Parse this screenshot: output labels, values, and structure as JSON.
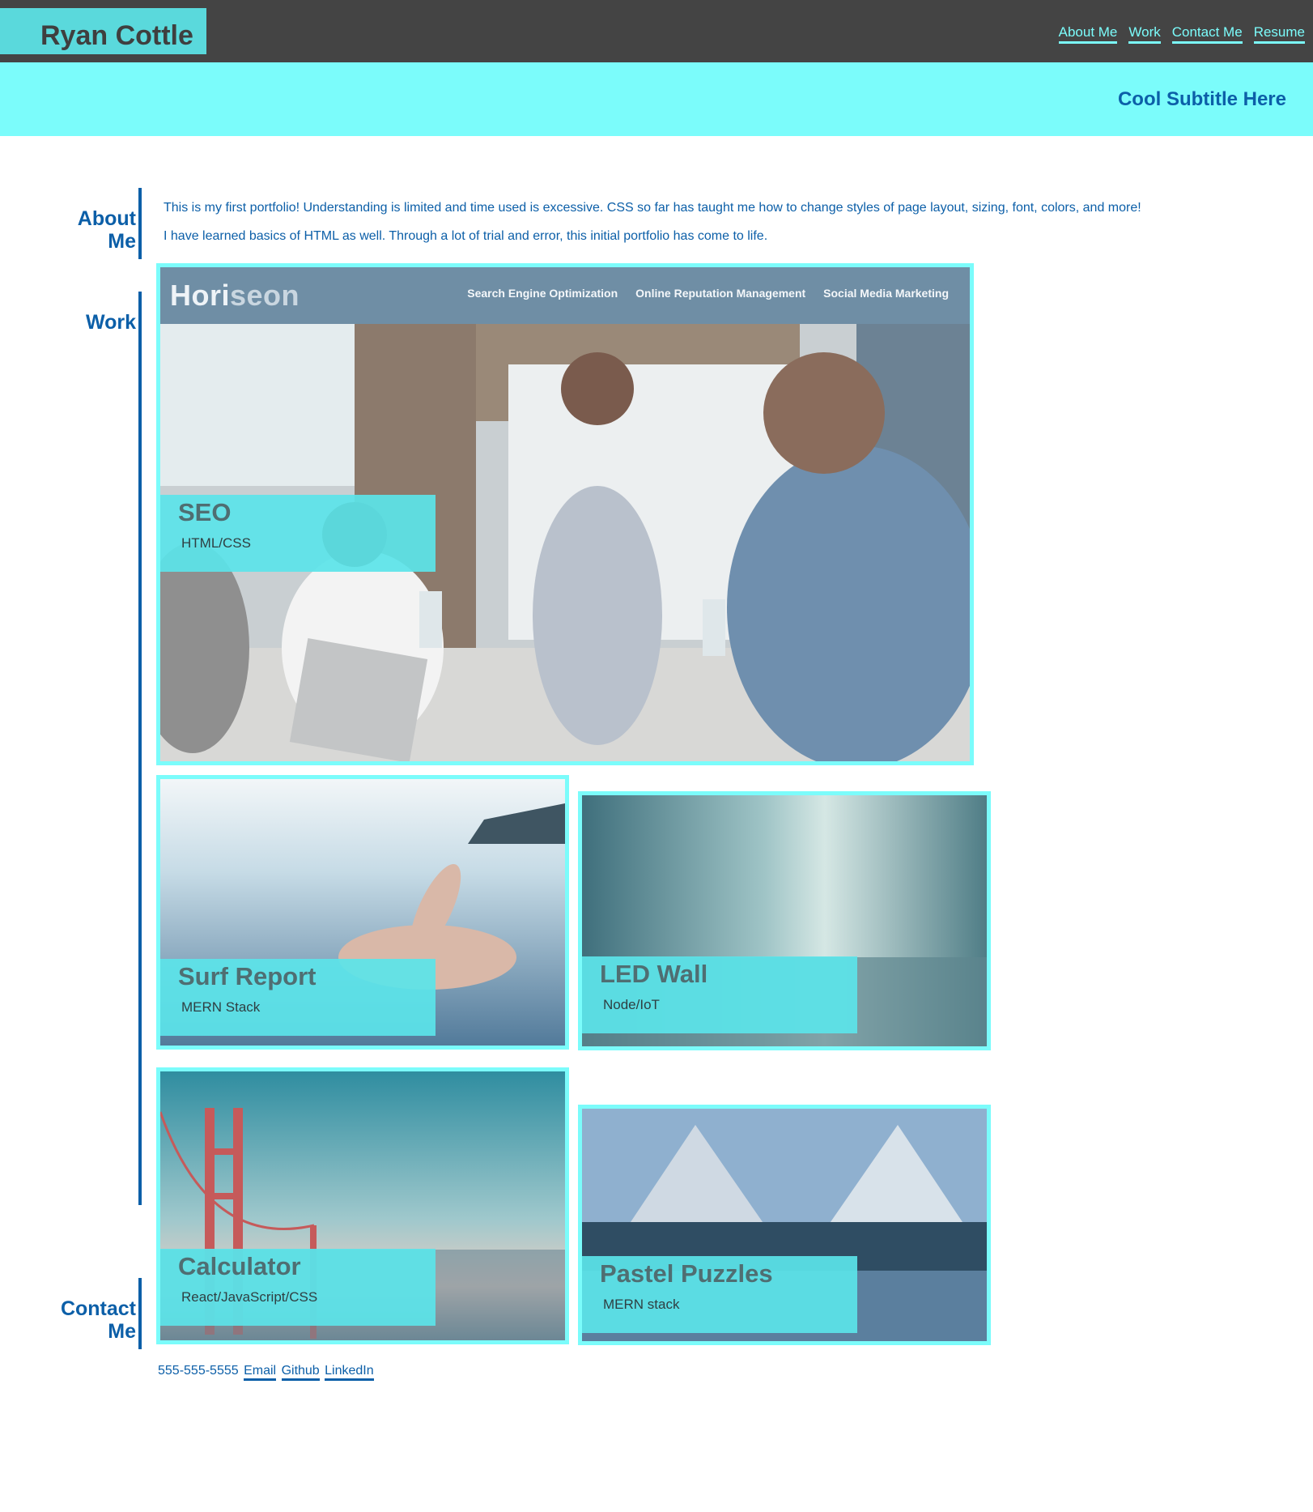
{
  "header": {
    "name": "Ryan Cottle",
    "nav": [
      "About Me",
      "Work",
      "Contact Me",
      "Resume"
    ]
  },
  "hero": {
    "subtitle": "Cool Subtitle Here"
  },
  "about": {
    "label_line1": "About",
    "label_line2": "Me",
    "paragraphs": [
      "This is my first portfolio! Understanding is limited and time used is excessive. CSS so far has taught me how to change styles of page layout, sizing, font, colors, and more!",
      "I have learned basics of HTML as well. Through a lot of trial and error, this initial portfolio has come to life."
    ]
  },
  "work": {
    "label": "Work",
    "featured": {
      "title": "SEO",
      "tech": "HTML/CSS",
      "screenshot": {
        "logo_part1": "Hori",
        "logo_part2": "seon",
        "nav": [
          "Search Engine Optimization",
          "Online Reputation Management",
          "Social Media Marketing"
        ]
      }
    },
    "projects": [
      {
        "title": "Surf Report",
        "tech": "MERN Stack"
      },
      {
        "title": "LED Wall",
        "tech": "Node/IoT"
      },
      {
        "title": "Calculator",
        "tech": "React/JavaScript/CSS"
      },
      {
        "title": "Pastel Puzzles",
        "tech": "MERN stack"
      }
    ]
  },
  "contact": {
    "label_line1": "Contact",
    "label_line2": "Me",
    "phone": "555-555-5555",
    "links": [
      "Email",
      "Github",
      "LinkedIn"
    ]
  },
  "colors": {
    "header_bg": "#444444",
    "accent_teal": "#5ad9dc",
    "accent_cyan": "#7bfcfb",
    "text_blue": "#0c5fa8"
  }
}
